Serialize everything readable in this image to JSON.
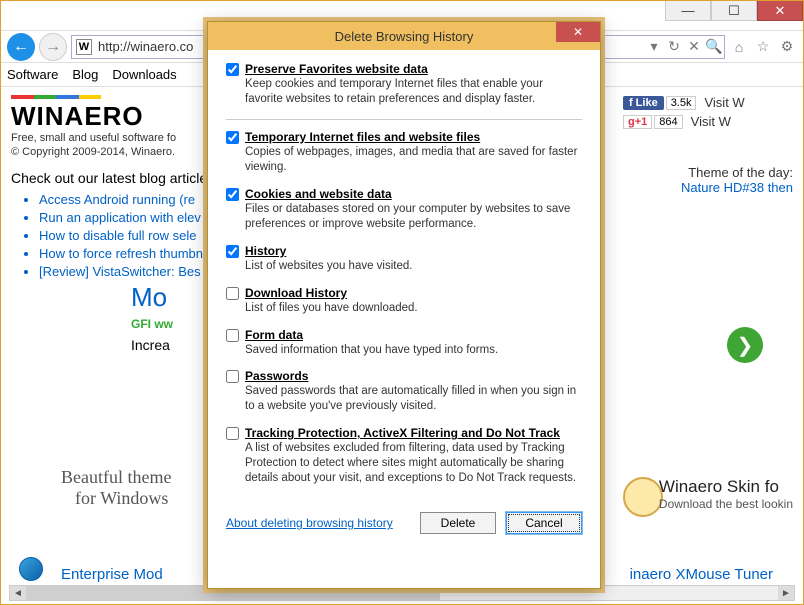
{
  "titlebar": {
    "min": "—",
    "max": "☐",
    "close": "✕"
  },
  "nav": {
    "back": "←",
    "fwd": "→"
  },
  "address": {
    "favicon": "W",
    "url": "http://winaero.co"
  },
  "ticons": {
    "home": "⌂",
    "star": "☆",
    "gear": "⚙",
    "refresh": "↻",
    "stop": "✕",
    "search": "🔍"
  },
  "menu": {
    "i0": "Software",
    "i1": "Blog",
    "i2": "Downloads"
  },
  "page": {
    "logo": "WINAERO",
    "tagline": "Free, small and useful software fo",
    "copyright": "© Copyright 2009-2014, Winaero.",
    "blogcheck": "Check out our latest blog article",
    "blog0": "Access Android running (re",
    "blog1": "Run an application with elev",
    "blog2": "How to disable full row sele",
    "blog3": "How to force refresh thumbn",
    "blog4": "[Review] VistaSwitcher: Bes",
    "mo": "Mo",
    "gfi": "GFI  ww",
    "inc": "Increa",
    "beautiful1": "Beautful theme",
    "beautiful2": "for Windows",
    "btmlink": "Enterprise Mod",
    "btmlink2": "inaero XMouse Tuner"
  },
  "right": {
    "like": "Like",
    "likecnt": "3.5k",
    "gplus": "+1",
    "gpluscnt": "864",
    "visit": "Visit W",
    "themeday": "Theme of the day:",
    "themelink": "Nature HD#38 then",
    "skintitle": "Winaero Skin fo",
    "skindl": "Download the best lookin"
  },
  "dialog": {
    "title": "Delete Browsing History",
    "opts": [
      {
        "checked": true,
        "label": "Preserve Favorites website data",
        "desc": "Keep cookies and temporary Internet files that enable your favorite websites to retain preferences and display faster."
      },
      {
        "checked": true,
        "label": "Temporary Internet files and website files",
        "desc": "Copies of webpages, images, and media that are saved for faster viewing."
      },
      {
        "checked": true,
        "label": "Cookies and website data",
        "desc": "Files or databases stored on your computer by websites to save preferences or improve website performance."
      },
      {
        "checked": true,
        "label": "History",
        "desc": "List of websites you have visited."
      },
      {
        "checked": false,
        "label": "Download History",
        "desc": "List of files you have downloaded."
      },
      {
        "checked": false,
        "label": "Form data",
        "desc": "Saved information that you have typed into forms."
      },
      {
        "checked": false,
        "label": "Passwords",
        "desc": "Saved passwords that are automatically filled in when you sign in to a website you've previously visited."
      },
      {
        "checked": false,
        "label": "Tracking Protection, ActiveX Filtering and Do Not Track",
        "desc": "A list of websites excluded from filtering, data used by Tracking Protection to detect where sites might automatically be sharing details about your visit, and exceptions to Do Not Track requests."
      }
    ],
    "link": "About deleting browsing history",
    "delete": "Delete",
    "cancel": "Cancel"
  }
}
